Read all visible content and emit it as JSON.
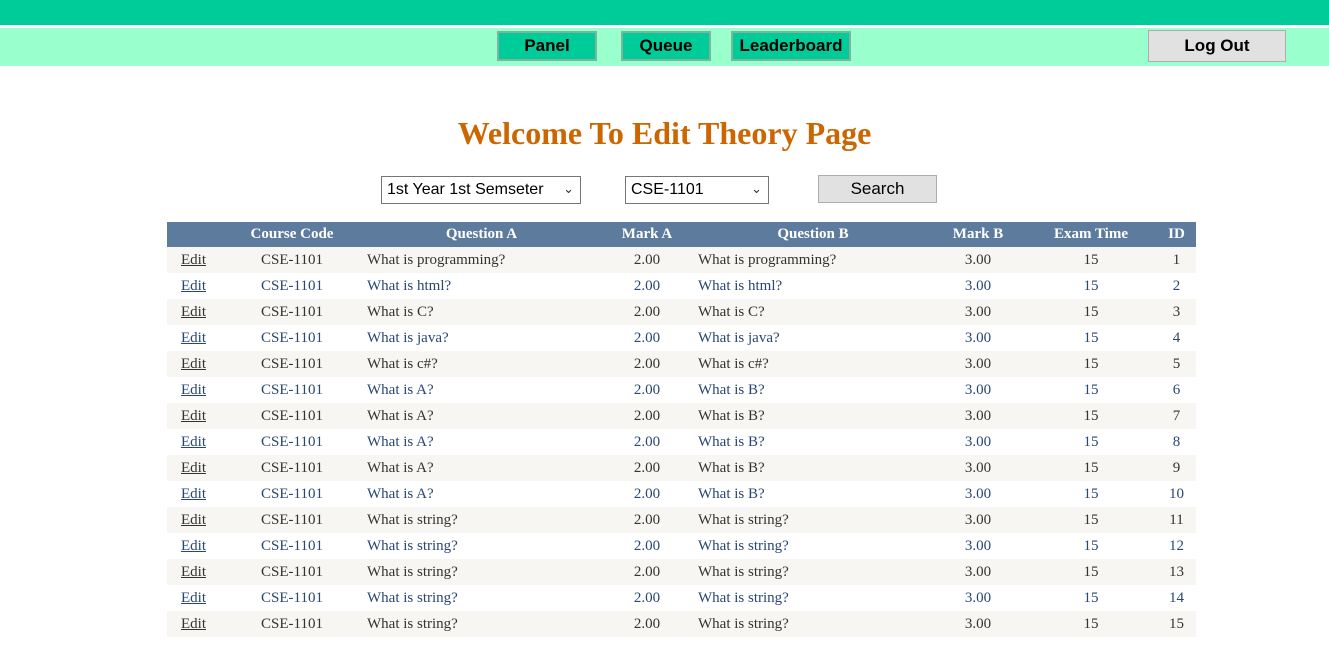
{
  "nav": {
    "panel": "Panel",
    "queue": "Queue",
    "leaderboard": "Leaderboard",
    "logout": "Log Out"
  },
  "page_title": "Welcome To Edit Theory Page",
  "filters": {
    "semester": "1st Year 1st Semseter",
    "course": "CSE-1101",
    "search": "Search"
  },
  "table": {
    "headers": [
      "",
      "Course Code",
      "Question A",
      "Mark A",
      "Question B",
      "Mark B",
      "Exam Time",
      "ID"
    ],
    "edit_label": "Edit",
    "rows": [
      {
        "code": "CSE-1101",
        "qa": "What is programming?",
        "ma": "2.00",
        "qb": "What is programming?",
        "mb": "3.00",
        "time": "15",
        "id": "1"
      },
      {
        "code": "CSE-1101",
        "qa": "What is html?",
        "ma": "2.00",
        "qb": "What is html?",
        "mb": "3.00",
        "time": "15",
        "id": "2"
      },
      {
        "code": "CSE-1101",
        "qa": "What is C?",
        "ma": "2.00",
        "qb": "What is C?",
        "mb": "3.00",
        "time": "15",
        "id": "3"
      },
      {
        "code": "CSE-1101",
        "qa": "What is java?",
        "ma": "2.00",
        "qb": "What is java?",
        "mb": "3.00",
        "time": "15",
        "id": "4"
      },
      {
        "code": "CSE-1101",
        "qa": "What is c#?",
        "ma": "2.00",
        "qb": "What is c#?",
        "mb": "3.00",
        "time": "15",
        "id": "5"
      },
      {
        "code": "CSE-1101",
        "qa": "What is A?",
        "ma": "2.00",
        "qb": "What is B?",
        "mb": "3.00",
        "time": "15",
        "id": "6"
      },
      {
        "code": "CSE-1101",
        "qa": "What is A?",
        "ma": "2.00",
        "qb": "What is B?",
        "mb": "3.00",
        "time": "15",
        "id": "7"
      },
      {
        "code": "CSE-1101",
        "qa": "What is A?",
        "ma": "2.00",
        "qb": "What is B?",
        "mb": "3.00",
        "time": "15",
        "id": "8"
      },
      {
        "code": "CSE-1101",
        "qa": "What is A?",
        "ma": "2.00",
        "qb": "What is B?",
        "mb": "3.00",
        "time": "15",
        "id": "9"
      },
      {
        "code": "CSE-1101",
        "qa": "What is A?",
        "ma": "2.00",
        "qb": "What is B?",
        "mb": "3.00",
        "time": "15",
        "id": "10"
      },
      {
        "code": "CSE-1101",
        "qa": "What is string?",
        "ma": "2.00",
        "qb": "What is string?",
        "mb": "3.00",
        "time": "15",
        "id": "11"
      },
      {
        "code": "CSE-1101",
        "qa": "What is string?",
        "ma": "2.00",
        "qb": "What is string?",
        "mb": "3.00",
        "time": "15",
        "id": "12"
      },
      {
        "code": "CSE-1101",
        "qa": "What is string?",
        "ma": "2.00",
        "qb": "What is string?",
        "mb": "3.00",
        "time": "15",
        "id": "13"
      },
      {
        "code": "CSE-1101",
        "qa": "What is string?",
        "ma": "2.00",
        "qb": "What is string?",
        "mb": "3.00",
        "time": "15",
        "id": "14"
      },
      {
        "code": "CSE-1101",
        "qa": "What is string?",
        "ma": "2.00",
        "qb": "What is string?",
        "mb": "3.00",
        "time": "15",
        "id": "15"
      }
    ]
  },
  "colors": {
    "top_bar": "#00cc99",
    "nav_bar": "#99ffcc",
    "title": "#cc6600",
    "table_header": "#5d7b9d",
    "row_alt": "#f7f6f3",
    "link_even": "#284775"
  },
  "icons": {
    "dropdown": "chevron-down-icon"
  }
}
